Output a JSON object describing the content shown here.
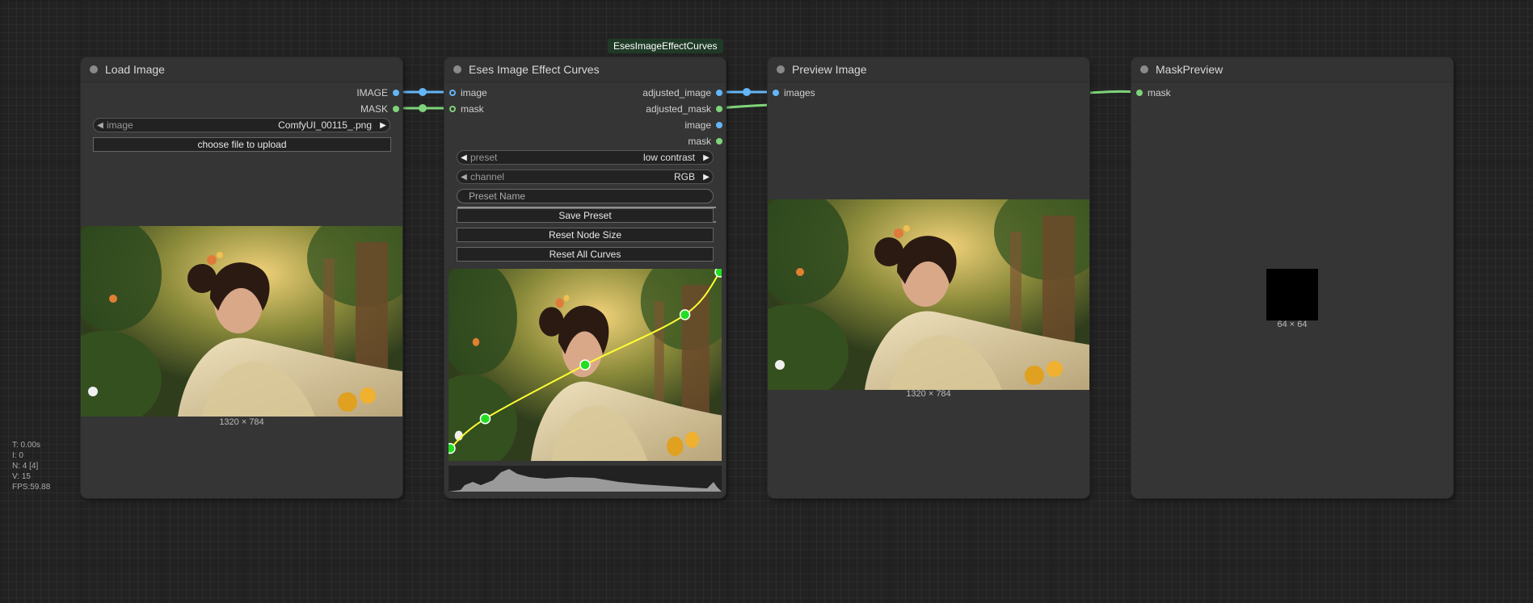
{
  "group_label": "EsesImageEffectCurves",
  "stats": [
    "T: 0.00s",
    "I: 0",
    "N: 4 [4]",
    "V: 15",
    "FPS:59.88"
  ],
  "load_image": {
    "title": "Load Image",
    "outputs": [
      "IMAGE",
      "MASK"
    ],
    "image_widget": {
      "label": "image",
      "value": "ComfyUI_00115_.png"
    },
    "upload_button": "choose file to upload",
    "caption": "1320 × 784"
  },
  "curves": {
    "title": "Eses Image Effect Curves",
    "inputs": [
      "image",
      "mask"
    ],
    "outputs": [
      "adjusted_image",
      "adjusted_mask",
      "image",
      "mask"
    ],
    "preset": {
      "label": "preset",
      "value": "low contrast"
    },
    "channel": {
      "label": "channel",
      "value": "RGB"
    },
    "preset_name_placeholder": "Preset Name",
    "buttons": [
      "Save Preset",
      "Reset Node Size",
      "Reset All Curves"
    ],
    "curve_points": [
      [
        0.0,
        0.05
      ],
      [
        0.13,
        0.21
      ],
      [
        0.5,
        0.5
      ],
      [
        0.87,
        0.77
      ],
      [
        1.0,
        1.0
      ]
    ]
  },
  "preview": {
    "title": "Preview Image",
    "input": "images",
    "caption": "1320 × 784"
  },
  "mask_preview": {
    "title": "MaskPreview",
    "input": "mask",
    "caption": "64 × 64"
  },
  "colors": {
    "image_link": "#64b5f6",
    "mask_link": "#7fd37a",
    "curve": "#ffff33",
    "point": "#22dd22"
  }
}
